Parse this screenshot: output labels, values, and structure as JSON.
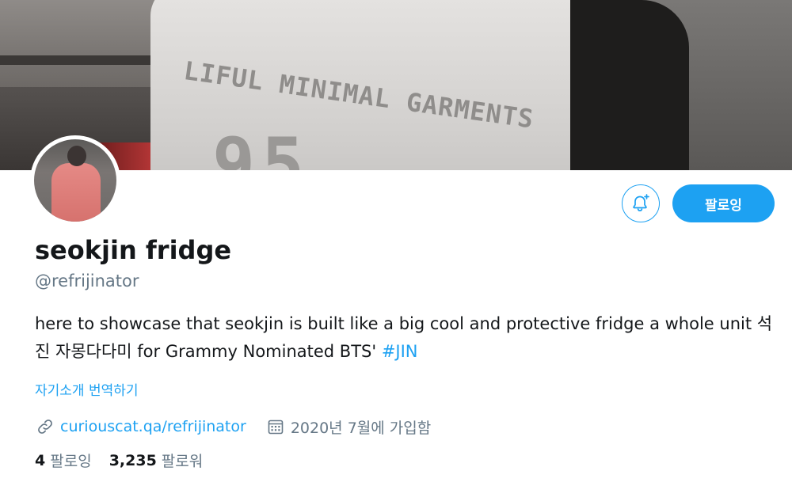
{
  "banner": {
    "shirt_text": "LIFUL MINIMAL GARMENTS",
    "shirt_number": "95"
  },
  "actions": {
    "notify_icon": "bell-plus-icon",
    "follow_label": "팔로잉"
  },
  "profile": {
    "name": "seokjin fridge",
    "handle": "@refrijinator",
    "bio_text": "here to showcase that seokjin is built like a big cool and protective fridge a whole unit 석진 자몽다다미 for Grammy Nominated BTS' ",
    "bio_hashtag": "#JIN",
    "translate_label": "자기소개 번역하기",
    "website": "curiouscat.qa/refrijinator",
    "joined": "2020년 7월에 가입함"
  },
  "stats": {
    "following_count": "4",
    "following_label": "팔로잉",
    "followers_count": "3,235",
    "followers_label": "팔로워"
  },
  "colors": {
    "accent": "#1da1f2",
    "secondary_text": "#657786",
    "primary_text": "#14171a"
  }
}
